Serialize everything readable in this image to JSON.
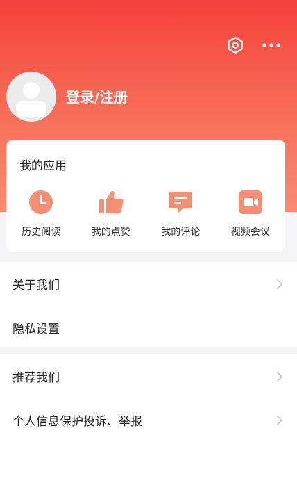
{
  "header": {
    "settings_icon": "hexagon-settings-icon",
    "more_icon": "more-dots-icon",
    "login_label": "登录/注册"
  },
  "my_apps": {
    "title": "我的应用",
    "items": [
      {
        "label": "历史阅读",
        "icon": "clock-icon"
      },
      {
        "label": "我的点赞",
        "icon": "thumbs-up-icon"
      },
      {
        "label": "我的评论",
        "icon": "comment-icon"
      },
      {
        "label": "视频会议",
        "icon": "video-icon"
      }
    ]
  },
  "menu": {
    "group1": [
      {
        "label": "关于我们",
        "chevron": true
      },
      {
        "label": "隐私设置",
        "chevron": false
      }
    ],
    "group2": [
      {
        "label": "推荐我们",
        "chevron": true
      },
      {
        "label": "个人信息保护投诉、举报",
        "chevron": true
      }
    ]
  },
  "colors": {
    "header_top": "#f5413b",
    "header_bottom": "#f98b71",
    "icon_accent": "#f58e72",
    "text_primary": "#222222"
  }
}
